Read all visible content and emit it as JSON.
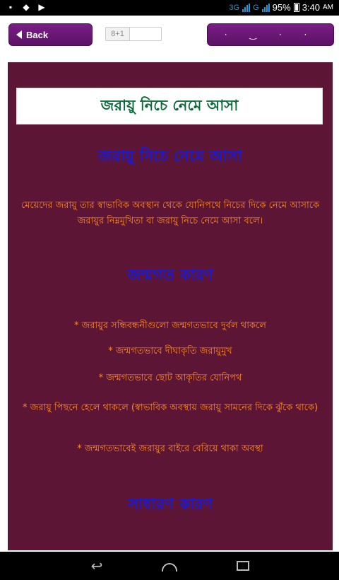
{
  "status": {
    "network": "3G",
    "network2": "G",
    "battery": "95%",
    "time": "3:40",
    "ampm": "AM"
  },
  "toolbar": {
    "back_label": "Back",
    "gplus_label": "8+1",
    "share_label": "· ‿ · ·"
  },
  "article": {
    "title": "জরায়ু নিচে নেমে আসা",
    "heading1": "জরায়ু নিচে নেমে আসা",
    "intro": "মেয়েদের জরায়ু তার স্বাভাবিক অবস্থান থেকে যোনিপথে নিচের দিকে নেমে আসাকে জরায়ুর নিম্নমুখিতা বা জরায়ু নিচে নেমে আসা বলে।",
    "heading2": "জন্মগত কারণ",
    "bullets": [
      "* জরায়ুর সন্ধিবন্ধনীগুলো জন্মগতভাবে দুর্বল থাকলে",
      "* জন্মগতভাবে দীঘাকৃতি জরায়ুমুখ",
      "* জন্মগতভাবে ছোট আকৃতির যোনিপথ",
      "* জরায়ু পিছনে হেলে থাকলে (স্বাভাবিক অবস্থায় জরায়ু সামনের দিকে ঝুঁকে থাকে)",
      "* জন্মগতভাবেই জরায়ুর বাইরে বেরিয়ে থাকা অবস্থা"
    ],
    "heading3": "সাধারণ কারণ"
  },
  "nav": {
    "back_glyph": "↩",
    "home_glyph": "",
    "recent_glyph": ""
  },
  "colors": {
    "content_bg": "#5d1535",
    "title_green": "#0a6b38",
    "heading_blue": "#1a1ad4",
    "text_orange": "#ff8c1a",
    "button_purple": "#6a1875"
  }
}
